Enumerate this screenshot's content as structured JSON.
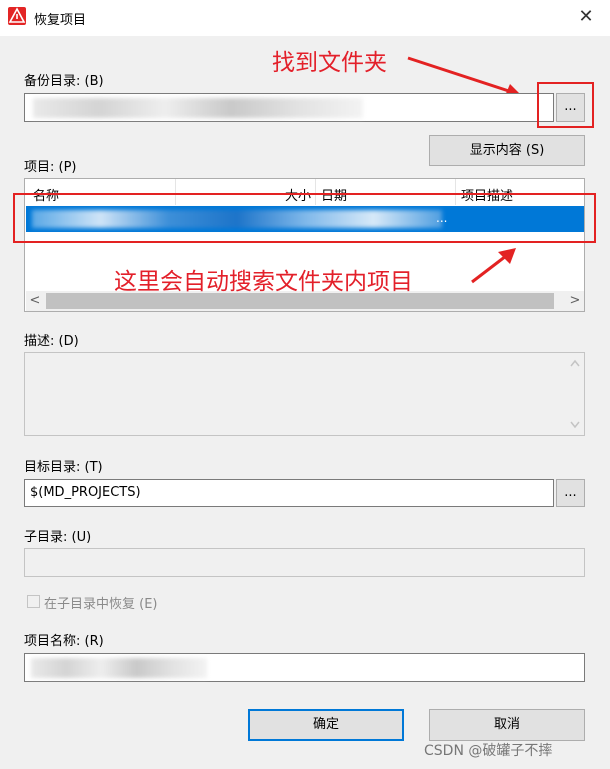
{
  "window": {
    "title": "恢复项目"
  },
  "backup_dir": {
    "label": "备份目录: (B)",
    "browse_label": "..."
  },
  "show_content_label": "显示内容 (S)",
  "projects": {
    "label": "项目: (P)",
    "columns": [
      "名称",
      "大小",
      "日期",
      "项目描述"
    ],
    "selected_row_tail": "..."
  },
  "description": {
    "label": "描述: (D)"
  },
  "target_dir": {
    "label": "目标目录: (T)",
    "value": "$(MD_PROJECTS)",
    "browse_label": "..."
  },
  "sub_dir": {
    "label": "子目录: (U)"
  },
  "restore_in_subdir": {
    "label": "在子目录中恢复 (E)"
  },
  "project_name": {
    "label": "项目名称: (R)"
  },
  "buttons": {
    "ok": "确定",
    "cancel": "取消"
  },
  "annotations": {
    "find_folder": "找到文件夹",
    "auto_search": "这里会自动搜索文件夹内项目"
  },
  "watermark": "CSDN @破罐子不摔",
  "colors": {
    "annotation": "#e32222",
    "selection": "#0078d7",
    "default_button_border": "#0078d7"
  },
  "icons": {
    "app": "app-logo-icon",
    "close": "close-icon"
  }
}
